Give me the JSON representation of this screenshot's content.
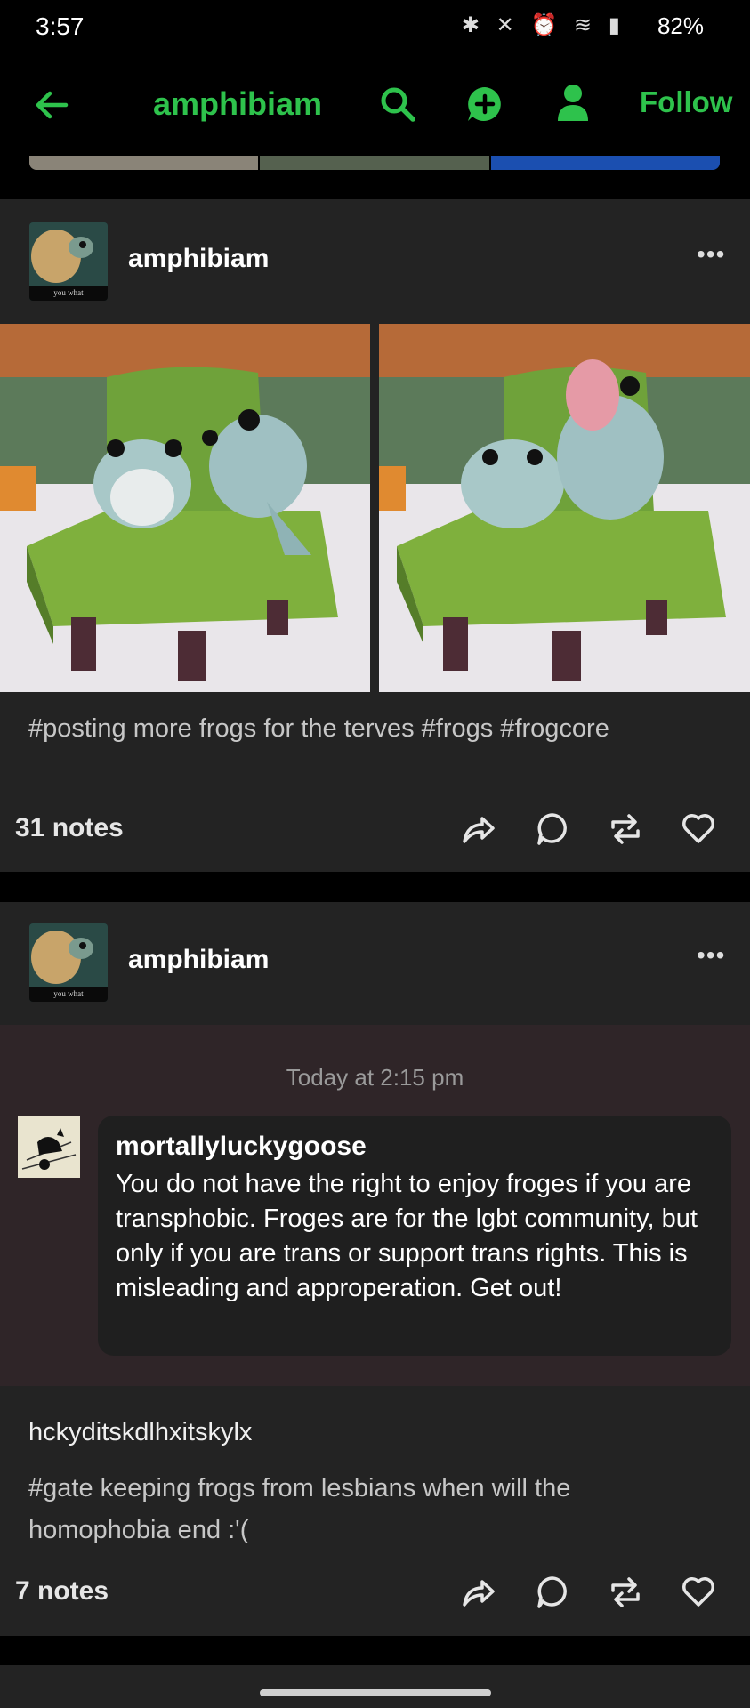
{
  "status_bar": {
    "time": "3:57",
    "battery": "82%"
  },
  "header": {
    "title": "amphibiam",
    "follow_label": "Follow"
  },
  "posts": [
    {
      "blog_name": "amphibiam",
      "avatar_caption": "you what",
      "tags": "#posting more frogs for the terves #frogs #frogcore",
      "notes": "31 notes"
    },
    {
      "blog_name": "amphibiam",
      "avatar_caption": "you what",
      "ask": {
        "timestamp": "Today at 2:15 pm",
        "asker": "mortallyluckygoose",
        "question": "You do not have the right to enjoy froges if you are transphobic. Froges are for the lgbt community, but only if you are trans or support trans rights. This is misleading and approperation. Get out!"
      },
      "answer_line": "hckyditskdlhxitskylx",
      "tags": "#gate keeping frogs from lesbians when will the homophobia end :'(",
      "notes": "7 notes"
    }
  ],
  "colors": {
    "accent": "#2ec24c",
    "card": "#232323",
    "ask_bg": "#2f2528"
  },
  "icons": [
    "back-arrow-icon",
    "search-icon",
    "new-post-icon",
    "account-icon",
    "share-icon",
    "reply-icon",
    "reblog-icon",
    "like-icon",
    "more-icon"
  ]
}
